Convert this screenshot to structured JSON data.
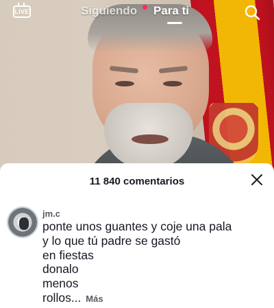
{
  "topbar": {
    "live_label": "LIVE",
    "tabs": [
      {
        "label": "Siguiendo",
        "active": false,
        "has_notification_dot": true
      },
      {
        "label": "Para ti",
        "active": true
      }
    ],
    "search_icon": "search-icon"
  },
  "comments": {
    "title": "11 840 comentarios",
    "close_icon": "close-icon",
    "items": [
      {
        "username": "jm.c",
        "lines": [
          "ponte unos guantes y coje una pala",
          "y lo que tú padre se gastó",
          "en fiestas",
          "donalo",
          "menos",
          "rollos..."
        ],
        "more_label": "Más"
      }
    ]
  },
  "colors": {
    "accent_red": "#fe2c55",
    "text_primary": "#161823",
    "text_secondary": "#555a63"
  }
}
